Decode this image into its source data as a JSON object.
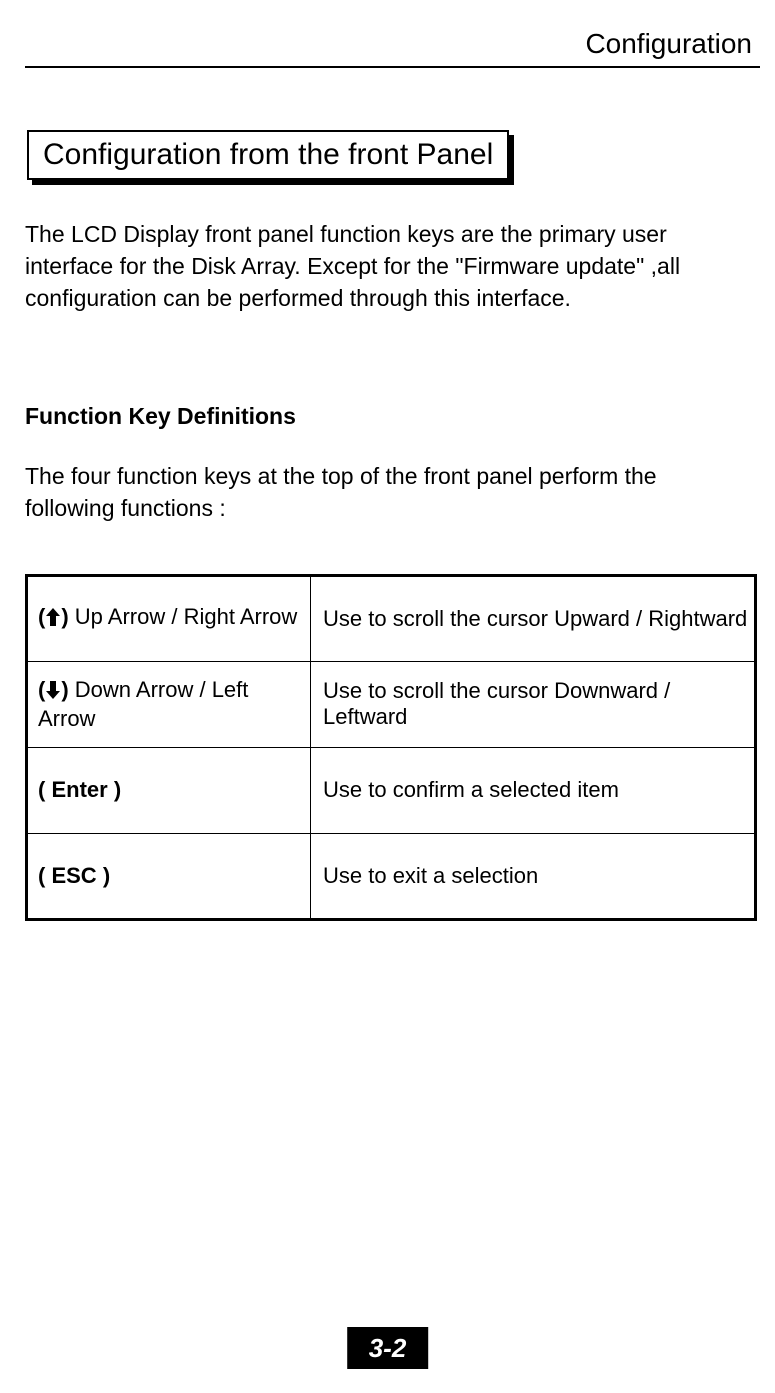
{
  "header": {
    "running_title": "Configuration"
  },
  "section": {
    "title": "Configuration from the front Panel",
    "intro": "The LCD Display front panel function keys are the primary user interface for the Disk Array. Except for the \"Firmware update\" ,all configuration can be performed through this interface.",
    "subheading": "Function Key Definitions",
    "subdesc": "The four function keys at the top of the front panel perform the following functions :"
  },
  "table": {
    "rows": [
      {
        "key_prefix": "(",
        "icon": "up-arrow",
        "key_suffix": ")",
        "key_text": " Up Arrow / Right Arrow",
        "desc": "Use to scroll the cursor Upward / Rightward"
      },
      {
        "key_prefix": "(",
        "icon": "down-arrow",
        "key_suffix": ")",
        "key_text": " Down Arrow / Left Arrow",
        "desc": "Use to scroll the cursor Downward / Leftward"
      },
      {
        "key_prefix": "( ",
        "bold_key": "Enter",
        "key_suffix": " )",
        "key_text": "",
        "desc": " Use to confirm a selected item"
      },
      {
        "key_prefix": "( ",
        "bold_key": "ESC",
        "key_suffix": " )",
        "key_text": "",
        "desc": "Use to exit a selection"
      }
    ]
  },
  "footer": {
    "page_number": "3-2"
  }
}
